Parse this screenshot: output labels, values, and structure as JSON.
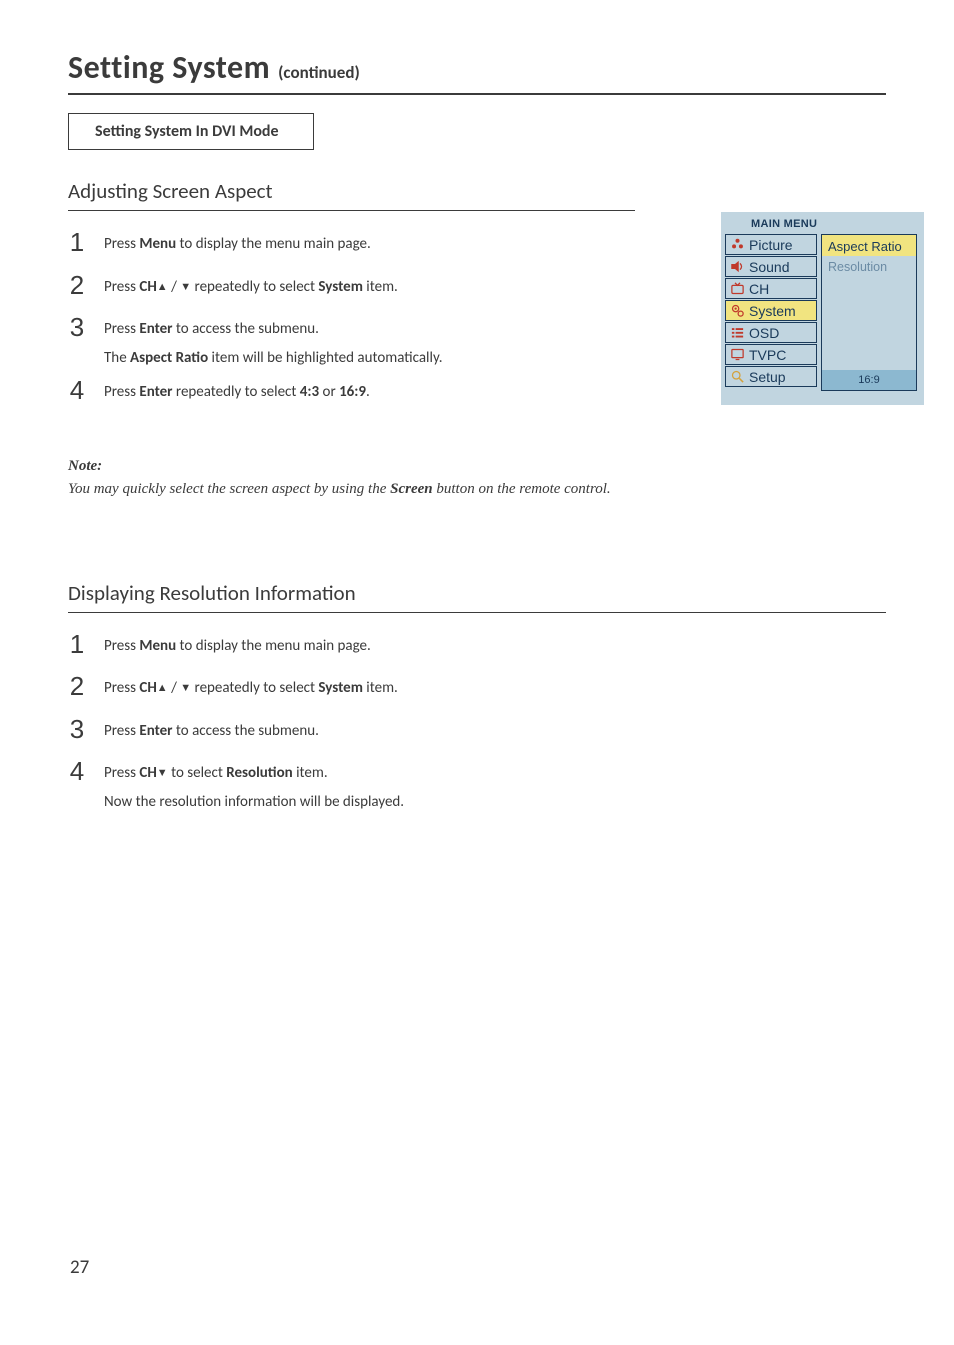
{
  "header": {
    "title": "Setting System",
    "subtitle": "(continued)"
  },
  "mode_box": "Setting System In DVI Mode",
  "section1": {
    "heading": "Adjusting Screen Aspect",
    "steps": [
      {
        "num": "1",
        "t1a": "Press  ",
        "t1b": "Menu",
        "t1c": " to display the menu main page."
      },
      {
        "num": "2",
        "t2a": "Press ",
        "t2b": "CH",
        "t2c": " / ",
        "t2d": "  repeatedly to select ",
        "t2e": "System",
        "t2f": " item."
      },
      {
        "num": "3",
        "t3a": "Press ",
        "t3b": "Enter",
        "t3c": " to access the submenu.",
        "l2a": "The ",
        "l2b": "Aspect Ratio",
        "l2c": " item will be highlighted automatically."
      },
      {
        "num": "4",
        "t4a": "Press ",
        "t4b": "Enter",
        "t4c": " repeatedly to select ",
        "t4d": "4:3",
        "t4e": " or ",
        "t4f": "16:9",
        "t4g": "."
      }
    ],
    "note_label": "Note:",
    "note_a": "You may quickly select the screen aspect by using the ",
    "note_b": "Screen",
    "note_c": " button on the remote control."
  },
  "section2": {
    "heading": "Displaying Resolution Information",
    "steps": [
      {
        "num": "1",
        "t1a": "Press  ",
        "t1b": "Menu",
        "t1c": " to display the menu main page."
      },
      {
        "num": "2",
        "t2a": "Press ",
        "t2b": "CH",
        "t2c": " / ",
        "t2d": "  repeatedly to select ",
        "t2e": "System",
        "t2f": " item."
      },
      {
        "num": "3",
        "t3a": "Press ",
        "t3b": "Enter",
        "t3c": " to access the submenu."
      },
      {
        "num": "4",
        "t4a": "Press ",
        "t4b": "CH",
        "t4c": "  to select ",
        "t4d": "Resolution",
        "t4e": " item.",
        "l2": "Now the resolution information will be displayed."
      }
    ]
  },
  "osd": {
    "title": "MAIN MENU",
    "left": [
      "Picture",
      "Sound",
      "CH",
      "System",
      "OSD",
      "TVPC",
      "Setup"
    ],
    "right": [
      "Aspect Ratio",
      "Resolution"
    ],
    "footer": "16:9"
  },
  "page_number": "27"
}
